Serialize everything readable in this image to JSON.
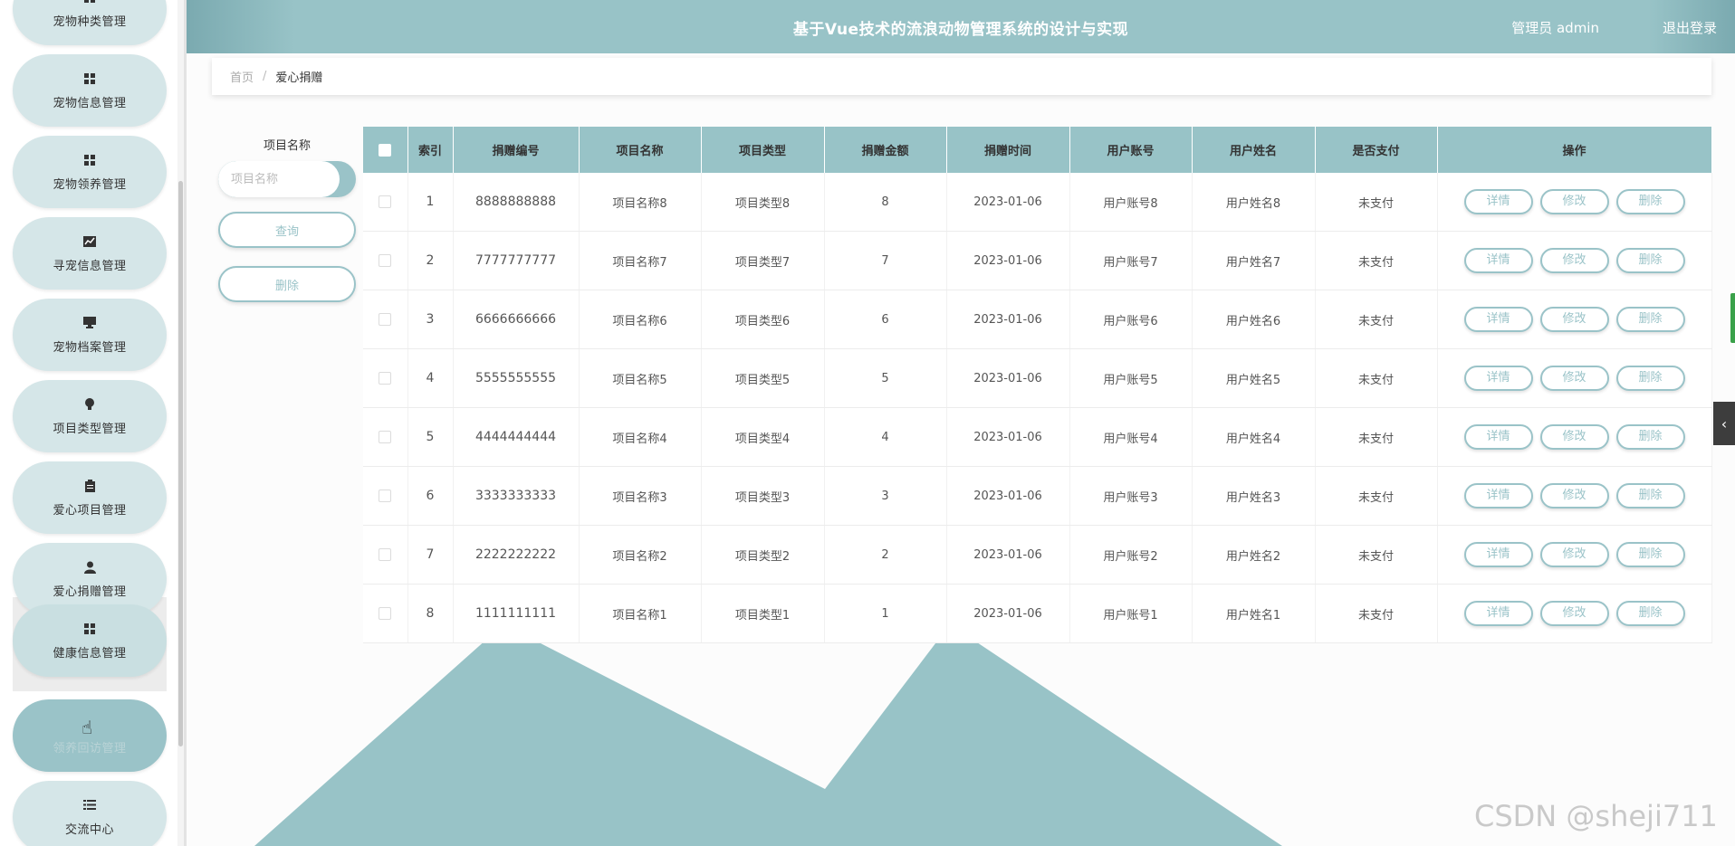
{
  "app": {
    "title": "基于Vue技术的流浪动物管理系统的设计与实现",
    "user_label": "管理员 admin",
    "logout_label": "退出登录"
  },
  "sidebar": {
    "items": [
      {
        "label": "宠物种类管理",
        "icon": "grid-icon"
      },
      {
        "label": "宠物信息管理",
        "icon": "grid-icon"
      },
      {
        "label": "宠物领养管理",
        "icon": "grid-icon"
      },
      {
        "label": "寻宠信息管理",
        "icon": "chart-icon"
      },
      {
        "label": "宠物档案管理",
        "icon": "monitor-icon"
      },
      {
        "label": "项目类型管理",
        "icon": "bulb-icon"
      },
      {
        "label": "爱心项目管理",
        "icon": "clipboard-icon"
      },
      {
        "label": "爱心捐赠管理",
        "icon": "user-icon"
      },
      {
        "label": "健康信息管理",
        "icon": "grid-icon"
      },
      {
        "label": "领养回访管理",
        "icon": "hand-cursor-icon"
      },
      {
        "label": "交流中心",
        "icon": "list-icon"
      }
    ]
  },
  "breadcrumb": {
    "home": "首页",
    "separator": "/",
    "current": "爱心捐赠"
  },
  "filter": {
    "field_label": "项目名称",
    "placeholder": "项目名称",
    "value": "",
    "query_label": "查询",
    "delete_label": "删除"
  },
  "table": {
    "columns": [
      "索引",
      "捐赠编号",
      "项目名称",
      "项目类型",
      "捐赠金额",
      "捐赠时间",
      "用户账号",
      "用户姓名",
      "是否支付",
      "操作"
    ],
    "rows": [
      {
        "index": "1",
        "donation_no": "8888888888",
        "project_name": "项目名称8",
        "project_type": "项目类型8",
        "amount": "8",
        "time": "2023-01-06",
        "account": "用户账号8",
        "user_name": "用户姓名8",
        "paid": "未支付"
      },
      {
        "index": "2",
        "donation_no": "7777777777",
        "project_name": "项目名称7",
        "project_type": "项目类型7",
        "amount": "7",
        "time": "2023-01-06",
        "account": "用户账号7",
        "user_name": "用户姓名7",
        "paid": "未支付"
      },
      {
        "index": "3",
        "donation_no": "6666666666",
        "project_name": "项目名称6",
        "project_type": "项目类型6",
        "amount": "6",
        "time": "2023-01-06",
        "account": "用户账号6",
        "user_name": "用户姓名6",
        "paid": "未支付"
      },
      {
        "index": "4",
        "donation_no": "5555555555",
        "project_name": "项目名称5",
        "project_type": "项目类型5",
        "amount": "5",
        "time": "2023-01-06",
        "account": "用户账号5",
        "user_name": "用户姓名5",
        "paid": "未支付"
      },
      {
        "index": "5",
        "donation_no": "4444444444",
        "project_name": "项目名称4",
        "project_type": "项目类型4",
        "amount": "4",
        "time": "2023-01-06",
        "account": "用户账号4",
        "user_name": "用户姓名4",
        "paid": "未支付"
      },
      {
        "index": "6",
        "donation_no": "3333333333",
        "project_name": "项目名称3",
        "project_type": "项目类型3",
        "amount": "3",
        "time": "2023-01-06",
        "account": "用户账号3",
        "user_name": "用户姓名3",
        "paid": "未支付"
      },
      {
        "index": "7",
        "donation_no": "2222222222",
        "project_name": "项目名称2",
        "project_type": "项目类型2",
        "amount": "2",
        "time": "2023-01-06",
        "account": "用户账号2",
        "user_name": "用户姓名2",
        "paid": "未支付"
      },
      {
        "index": "8",
        "donation_no": "1111111111",
        "project_name": "项目名称1",
        "project_type": "项目类型1",
        "amount": "1",
        "time": "2023-01-06",
        "account": "用户账号1",
        "user_name": "用户姓名1",
        "paid": "未支付"
      }
    ],
    "actions": {
      "detail": "详情",
      "edit": "修改",
      "delete": "删除"
    }
  },
  "watermark": "CSDN @sheji711",
  "colors": {
    "accent": "#98c3c7",
    "sidebar_item": "#d5e6e8",
    "sidebar_hover": "#9ac3c8",
    "mountain": "#98c3c7"
  }
}
